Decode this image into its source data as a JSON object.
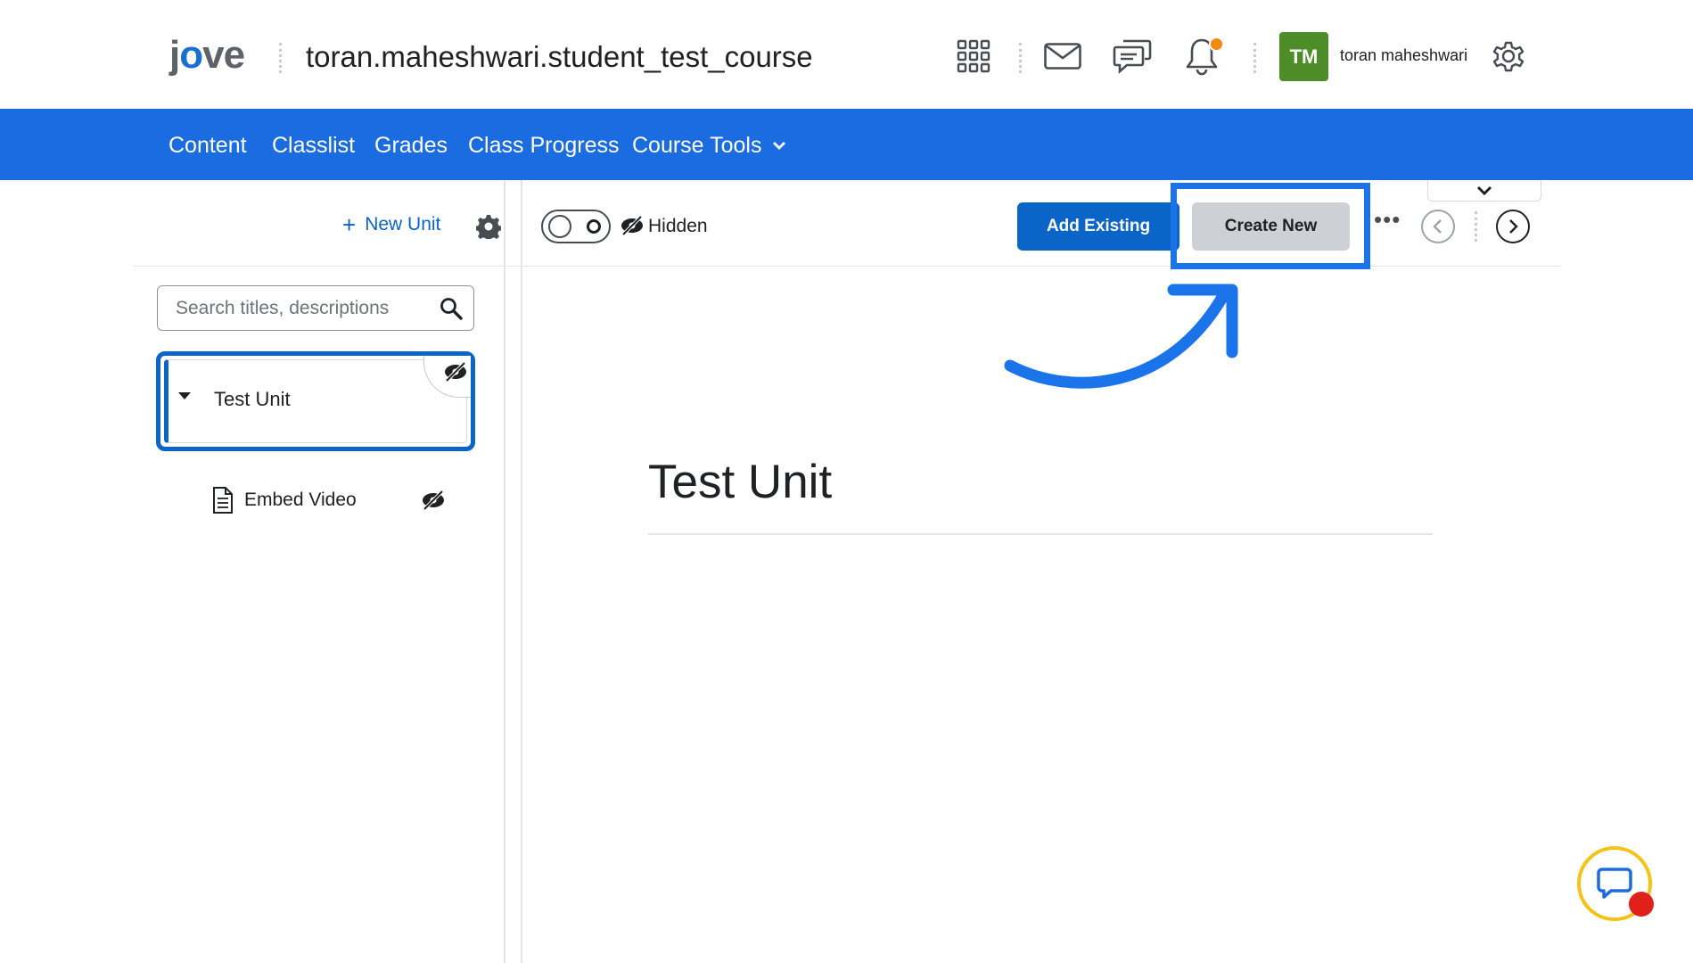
{
  "header": {
    "logo_text": "jove",
    "course_title": "toran.maheshwari.student_test_course",
    "avatar_initials": "TM",
    "avatar_color": "#4e8c28",
    "username": "toran maheshwari",
    "icons": [
      "apps-grid-icon",
      "mail-icon",
      "chat-icon",
      "bell-icon",
      "gear-icon"
    ],
    "notification_dot_color": "#f18a0e"
  },
  "nav": {
    "bar_color": "#1b6be1",
    "items": [
      {
        "label": "Content"
      },
      {
        "label": "Classlist"
      },
      {
        "label": "Grades"
      },
      {
        "label": "Class Progress"
      },
      {
        "label": "Course Tools"
      }
    ]
  },
  "sidebar": {
    "new_unit_label": "New Unit",
    "search_placeholder": "Search titles, descriptions",
    "units": [
      {
        "title": "Test Unit",
        "selected": true,
        "hidden": true
      }
    ],
    "items": [
      {
        "title": "Embed Video",
        "type": "document",
        "hidden": true
      }
    ]
  },
  "toolbar": {
    "visibility_label": "Hidden",
    "visibility_on": false,
    "add_existing_label": "Add Existing",
    "create_new_label": "Create New",
    "more_label": "•••",
    "accent_color": "#0b64c8",
    "highlight_color": "#1a73e8"
  },
  "main": {
    "title": "Test Unit"
  },
  "chat_widget": {
    "ring_color": "#f3c317",
    "badge_color": "#e0211b"
  }
}
